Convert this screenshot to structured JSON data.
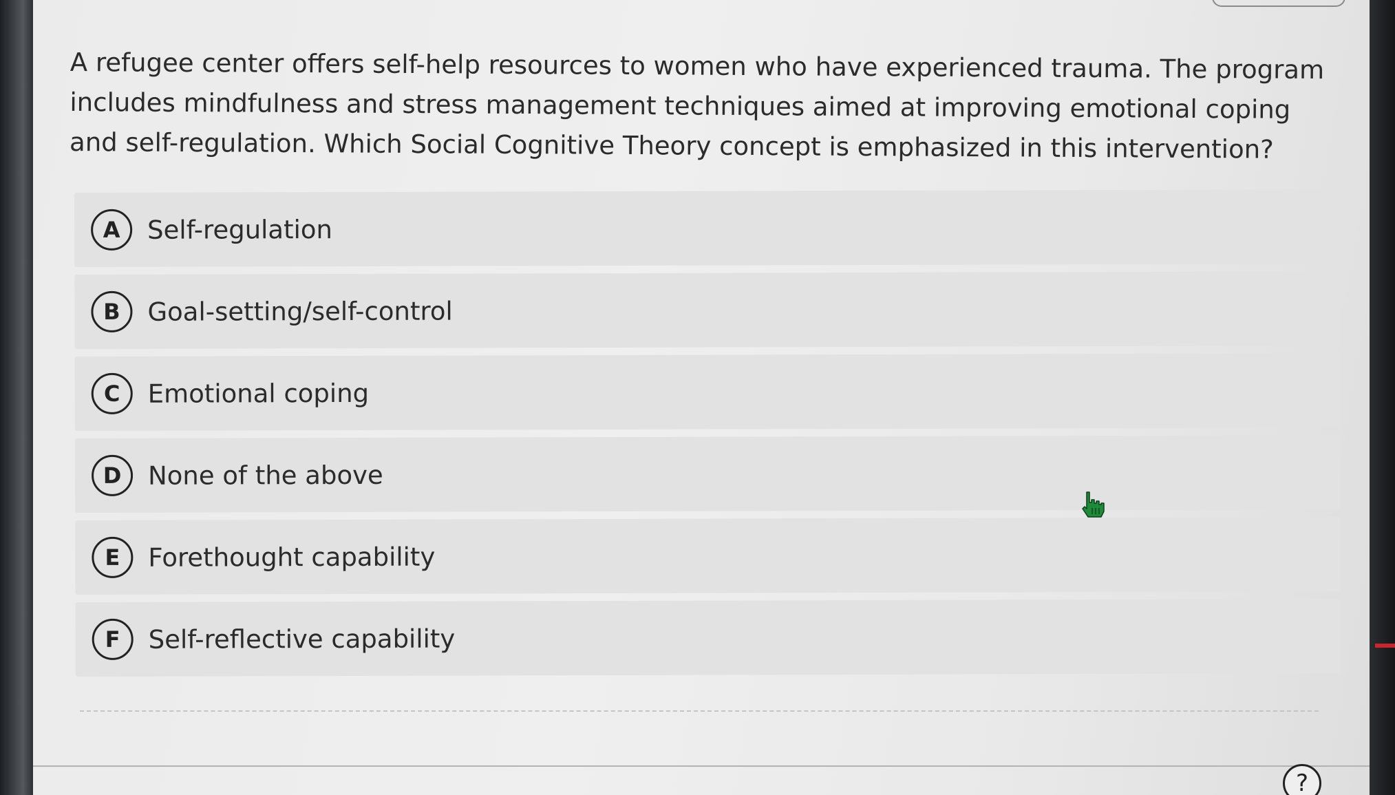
{
  "question": {
    "text": "A refugee center offers self-help resources to women who have experienced trauma. The program includes mindfulness and stress management techniques aimed at improving emotional coping and self-regulation. Which Social Cognitive Theory concept is emphasized in this intervention?"
  },
  "options": [
    {
      "letter": "A",
      "label": "Self-regulation"
    },
    {
      "letter": "B",
      "label": "Goal-setting/self-control"
    },
    {
      "letter": "C",
      "label": "Emotional coping"
    },
    {
      "letter": "D",
      "label": "None of the above"
    },
    {
      "letter": "E",
      "label": "Forethought capability"
    },
    {
      "letter": "F",
      "label": "Self-reflective capability"
    }
  ],
  "help": {
    "symbol": "?"
  },
  "colors": {
    "background": "#ebebeb",
    "option_background": "#e2e2e2",
    "text": "#2b2b2b",
    "cursor": "#1f8a3a"
  },
  "icons": {
    "cursor": "hand-pointer-icon",
    "help": "question-circle-icon"
  }
}
